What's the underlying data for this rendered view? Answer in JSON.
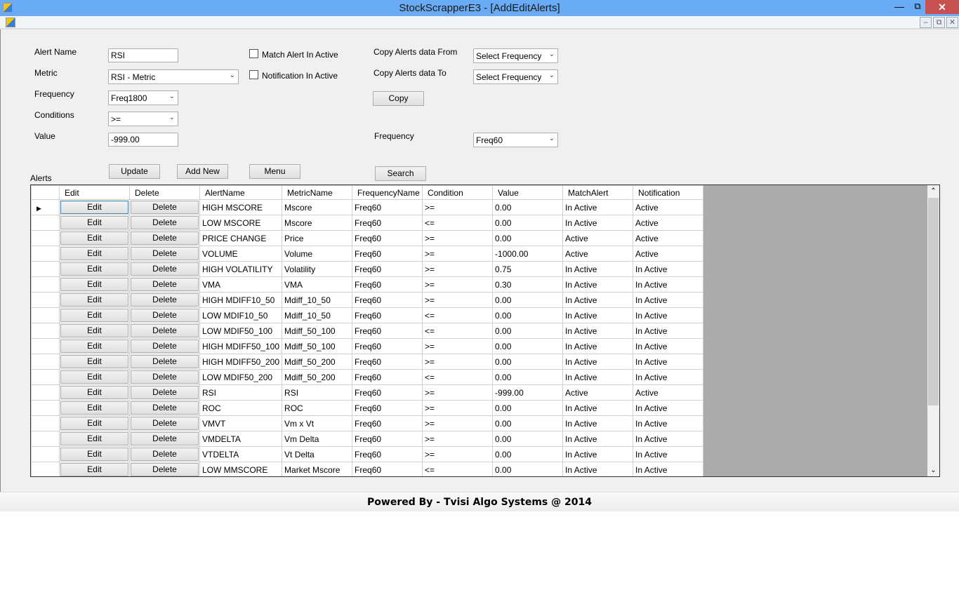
{
  "window": {
    "title": "StockScrapperE3 - [AddEditAlerts]"
  },
  "form": {
    "alert_name_label": "Alert Name",
    "alert_name_value": "RSI",
    "metric_label": "Metric",
    "metric_value": "RSI - Metric",
    "frequency_label": "Frequency",
    "frequency_value": "Freq1800",
    "conditions_label": "Conditions",
    "conditions_value": ">=",
    "value_label": "Value",
    "value_value": "-999.00",
    "match_alert_label": "Match Alert In Active",
    "match_alert_checked": false,
    "notification_label": "Notification In Active",
    "notification_checked": false,
    "copy_from_label": "Copy Alerts data From",
    "copy_from_value": "Select Frequency",
    "copy_to_label": "Copy Alerts data To",
    "copy_to_value": "Select Frequency",
    "copy_button": "Copy",
    "search_frequency_label": "Frequency",
    "search_frequency_value": "Freq60",
    "update_button": "Update",
    "add_new_button": "Add New",
    "menu_button": "Menu",
    "search_button": "Search",
    "alerts_label": "Alerts"
  },
  "grid": {
    "columns": [
      "Edit",
      "Delete",
      "AlertName",
      "MetricName",
      "FrequencyName",
      "Condition",
      "Value",
      "MatchAlert",
      "Notification"
    ],
    "edit_label": "Edit",
    "delete_label": "Delete",
    "rows": [
      [
        "HIGH MSCORE",
        "Mscore",
        "Freq60",
        ">=",
        "0.00",
        "In Active",
        "Active"
      ],
      [
        "LOW MSCORE",
        "Mscore",
        "Freq60",
        "<=",
        "0.00",
        "In Active",
        "Active"
      ],
      [
        "PRICE CHANGE",
        "Price",
        "Freq60",
        ">=",
        "0.00",
        "Active",
        "Active"
      ],
      [
        "VOLUME",
        "Volume",
        "Freq60",
        ">=",
        "-1000.00",
        "Active",
        "Active"
      ],
      [
        "HIGH VOLATILITY",
        "Volatility",
        "Freq60",
        ">=",
        "0.75",
        "In Active",
        "In Active"
      ],
      [
        "VMA",
        "VMA",
        "Freq60",
        ">=",
        "0.30",
        "In Active",
        "In Active"
      ],
      [
        "HIGH MDIFF10_50",
        "Mdiff_10_50",
        "Freq60",
        ">=",
        "0.00",
        "In Active",
        "In Active"
      ],
      [
        "LOW MDIF10_50",
        "Mdiff_10_50",
        "Freq60",
        "<=",
        "0.00",
        "In Active",
        "In Active"
      ],
      [
        "LOW MDIF50_100",
        "Mdiff_50_100",
        "Freq60",
        "<=",
        "0.00",
        "In Active",
        "In Active"
      ],
      [
        "HIGH MDIFF50_100",
        "Mdiff_50_100",
        "Freq60",
        ">=",
        "0.00",
        "In Active",
        "In Active"
      ],
      [
        "HIGH MDIFF50_200",
        "Mdiff_50_200",
        "Freq60",
        ">=",
        "0.00",
        "In Active",
        "In Active"
      ],
      [
        "LOW MDIF50_200",
        "Mdiff_50_200",
        "Freq60",
        "<=",
        "0.00",
        "In Active",
        "In Active"
      ],
      [
        "RSI",
        "RSI",
        "Freq60",
        ">=",
        "-999.00",
        "Active",
        "Active"
      ],
      [
        "ROC",
        "ROC",
        "Freq60",
        ">=",
        "0.00",
        "In Active",
        "In Active"
      ],
      [
        "VMVT",
        "Vm x Vt",
        "Freq60",
        ">=",
        "0.00",
        "In Active",
        "In Active"
      ],
      [
        "VMDELTA",
        "Vm Delta",
        "Freq60",
        ">=",
        "0.00",
        "In Active",
        "In Active"
      ],
      [
        "VTDELTA",
        "Vt Delta",
        "Freq60",
        ">=",
        "0.00",
        "In Active",
        "In Active"
      ],
      [
        "LOW MMSCORE",
        "Market Mscore",
        "Freq60",
        "<=",
        "0.00",
        "In Active",
        "In Active"
      ]
    ]
  },
  "status": {
    "powered_by": "Powered By - Tvisi Algo Systems @ 2014"
  }
}
